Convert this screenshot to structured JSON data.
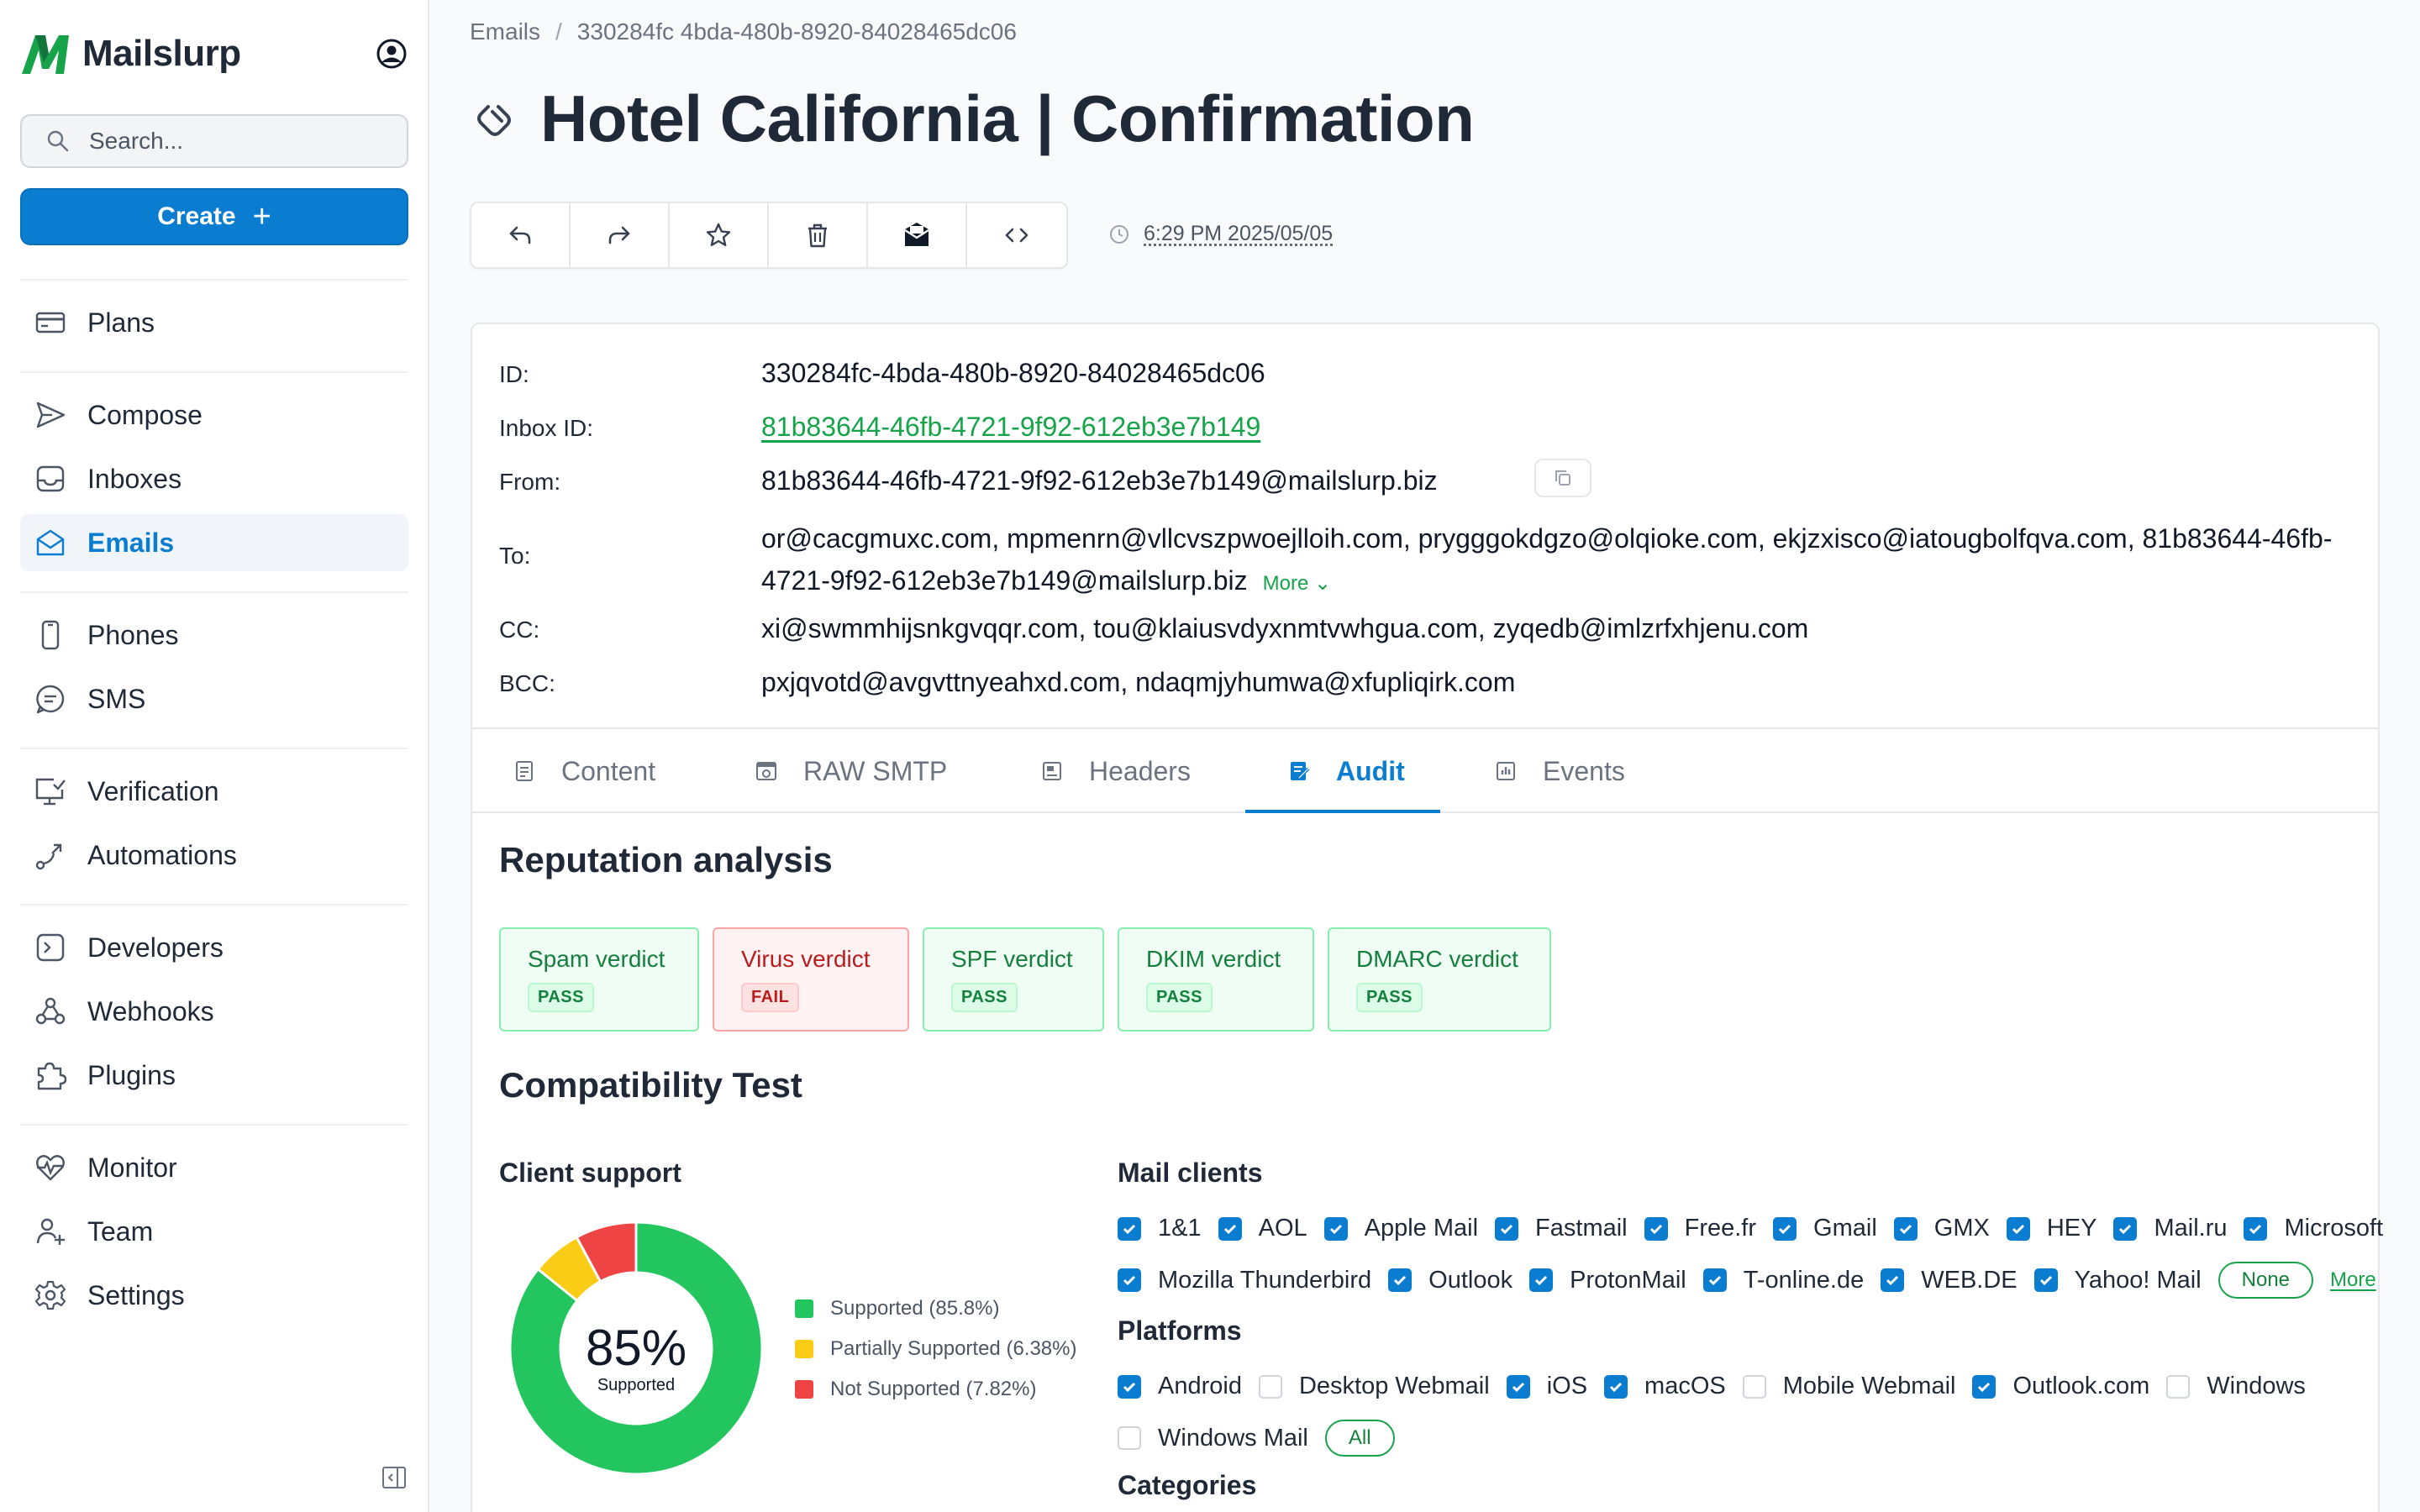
{
  "brand": {
    "name": "Mailslurp",
    "accent": "#0b7dd1",
    "logo_green": "#16a34a"
  },
  "sidebar": {
    "search_placeholder": "Search...",
    "create_label": "Create",
    "items": [
      {
        "label": "Plans",
        "icon": "credit-card-icon"
      },
      {
        "label": "Compose",
        "icon": "send-icon"
      },
      {
        "label": "Inboxes",
        "icon": "inbox-icon"
      },
      {
        "label": "Emails",
        "icon": "mail-open-icon",
        "active": true
      },
      {
        "label": "Phones",
        "icon": "phone-icon"
      },
      {
        "label": "SMS",
        "icon": "chat-icon"
      },
      {
        "label": "Verification",
        "icon": "monitor-check-icon"
      },
      {
        "label": "Automations",
        "icon": "flow-icon"
      },
      {
        "label": "Developers",
        "icon": "terminal-icon"
      },
      {
        "label": "Webhooks",
        "icon": "webhook-icon"
      },
      {
        "label": "Plugins",
        "icon": "puzzle-icon"
      },
      {
        "label": "Monitor",
        "icon": "heartbeat-icon"
      },
      {
        "label": "Team",
        "icon": "users-icon"
      },
      {
        "label": "Settings",
        "icon": "gear-icon"
      }
    ]
  },
  "breadcrumb": {
    "root": "Emails",
    "sep": "/",
    "current": "330284fc 4bda-480b-8920-84028465dc06"
  },
  "page_title": "Hotel California | Confirmation",
  "toolbar": {
    "buttons": [
      "reply-icon",
      "forward-icon",
      "star-icon",
      "trash-icon",
      "mail-icon",
      "code-icon"
    ],
    "timestamp": "6:29 PM 2025/05/05"
  },
  "meta": {
    "id_label": "ID:",
    "id_value": "330284fc-4bda-480b-8920-84028465dc06",
    "inbox_label": "Inbox ID:",
    "inbox_value": "81b83644-46fb-4721-9f92-612eb3e7b149",
    "from_label": "From:",
    "from_value": "81b83644-46fb-4721-9f92-612eb3e7b149@mailslurp.biz",
    "to_label": "To:",
    "to_value": "or@cacgmuxc.com, mpmenrn@vllcvszpwoejlloih.com, prygggokdgzo@olqioke.com, ekjzxisco@iatougbolfqva.com, 81b83644-46fb-4721-9f92-612eb3e7b149@mailslurp.biz",
    "to_more": "More",
    "cc_label": "CC:",
    "cc_value": "xi@swmmhijsnkgvqqr.com, tou@klaiusvdyxnmtvwhgua.com, zyqedb@imlzrfxhjenu.com",
    "bcc_label": "BCC:",
    "bcc_value": "pxjqvotd@avgvttnyeahxd.com, ndaqmjyhumwa@xfupliqirk.com"
  },
  "tabs": [
    {
      "label": "Content",
      "icon": "document-icon"
    },
    {
      "label": "RAW SMTP",
      "icon": "browser-icon"
    },
    {
      "label": "Headers",
      "icon": "header-icon"
    },
    {
      "label": "Audit",
      "icon": "audit-icon",
      "active": true
    },
    {
      "label": "Events",
      "icon": "bar-chart-icon"
    }
  ],
  "reputation": {
    "title": "Reputation analysis",
    "verdicts": [
      {
        "label": "Spam verdict",
        "status": "PASS"
      },
      {
        "label": "Virus verdict",
        "status": "FAIL"
      },
      {
        "label": "SPF verdict",
        "status": "PASS"
      },
      {
        "label": "DKIM verdict",
        "status": "PASS"
      },
      {
        "label": "DMARC verdict",
        "status": "PASS"
      }
    ]
  },
  "compatibility": {
    "title": "Compatibility Test",
    "client_support": {
      "title": "Client support",
      "big": "85%",
      "small": "Supported",
      "legend": [
        {
          "label": "Supported (85.8%)",
          "color": "#22c55e"
        },
        {
          "label": "Partially Supported (6.38%)",
          "color": "#facc15"
        },
        {
          "label": "Not Supported (7.82%)",
          "color": "#ef4444"
        }
      ]
    },
    "mail_clients_title": "Mail clients",
    "mail_clients": [
      "1&1",
      "AOL",
      "Apple Mail",
      "Fastmail",
      "Free.fr",
      "Gmail",
      "GMX",
      "HEY",
      "Mail.ru",
      "Microsoft",
      "Mozilla Thunderbird",
      "Outlook",
      "ProtonMail",
      "T-online.de",
      "WEB.DE",
      "Yahoo! Mail"
    ],
    "mail_none": "None",
    "mail_more": "More",
    "platforms_title": "Platforms",
    "platforms": [
      {
        "label": "Android",
        "checked": true
      },
      {
        "label": "Desktop Webmail",
        "checked": false
      },
      {
        "label": "iOS",
        "checked": true
      },
      {
        "label": "macOS",
        "checked": true
      },
      {
        "label": "Mobile Webmail",
        "checked": false
      },
      {
        "label": "Outlook.com",
        "checked": true
      },
      {
        "label": "Windows",
        "checked": false
      },
      {
        "label": "Windows Mail",
        "checked": false
      }
    ],
    "platforms_all": "All",
    "categories_title": "Categories"
  },
  "chart_data": {
    "type": "pie",
    "title": "Client support",
    "categories": [
      "Supported",
      "Partially Supported",
      "Not Supported"
    ],
    "values": [
      85.8,
      6.38,
      7.82
    ],
    "colors": [
      "#22c55e",
      "#facc15",
      "#ef4444"
    ],
    "center_label": "85%",
    "legend": "right"
  }
}
